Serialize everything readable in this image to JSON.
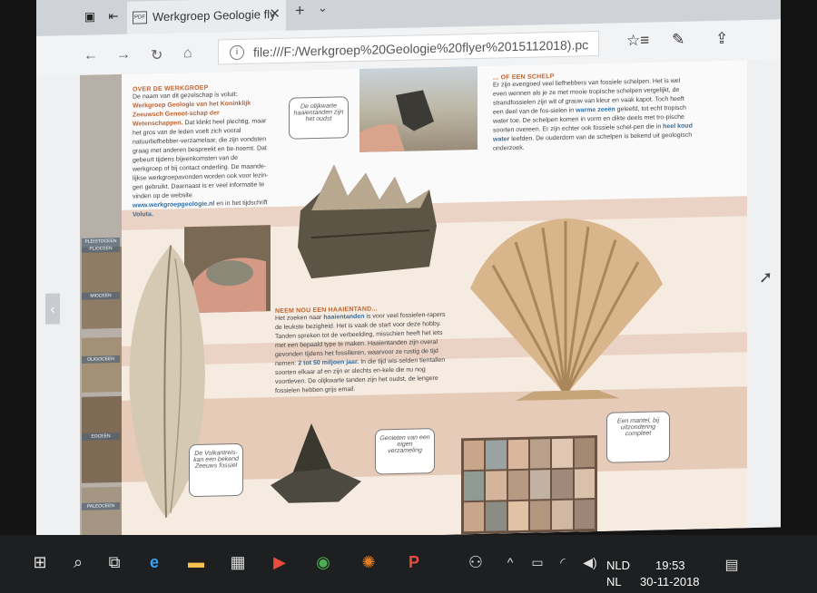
{
  "browser": {
    "tab_title": "Werkgroep Geologie fly",
    "tab_page_icon": "PDF",
    "tab_close": "✕",
    "new_tab": "+",
    "tab_menu": "⌄",
    "url": "file:///F:/Werkgroep%20Geologie%20flyer%2015112018).pc",
    "icons": [
      "tab-preview-icon",
      "set-aside-tabs-icon",
      "back-icon",
      "forward-icon",
      "refresh-icon",
      "home-icon",
      "info-icon",
      "favorite-star-icon",
      "favorites-hub-icon",
      "pen-icon",
      "share-icon"
    ]
  },
  "pdf": {
    "stripe_labels": [
      "PLEISTOCEEN",
      "PLIOCEEN",
      "MIOCEEN",
      "OLIGOCEEN",
      "EOCEEN",
      "PALEOCEEN"
    ],
    "about": {
      "heading": "OVER DE WERKGROEP",
      "p1_a": "De naam van dit gezelschap is voluit:",
      "p1_b": "Werkgroep Geologie van het Koninklijk Zeeuwsch Genoot-schap der Wetenschappen.",
      "p1_c": "Dat klinkt heel plechtig, maar het gros van de leden voelt zich vooral natuurliefhebber-verzamelaar, die zijn vondsten graag met anderen bespreekt en be-noemt. Dat gebeurt tijdens bijeenkomsten van de werkgroep of bij contact onderling. De maande-lijkse werkgroepavonden worden ook voor lezin-gen gebruikt. Daarnaast is er veel informatie te vinden op de website",
      "p1_d": "www.werkgroepgeologie.nl",
      "p1_e": "en in het tijdschrift",
      "p1_f": "Voluta."
    },
    "shell": {
      "heading": "... OF EEN SCHELP",
      "p1_a": "Er zijn evengoed veel liefhebbers van fossiele schelpen. Het is wel even wennen als je ze met mooie tropische schelpen vergelijkt, de strandfossielen zijn wit of grauw van kleur en vaak kapot. Toch heeft een deel van de fos-sielen in",
      "p1_b": "warme zeeën",
      "p1_c": "geleefd, tot echt tropisch water toe. De schelpen komen in vorm en dikte deels met tro-pische soorten overeen. Er zijn echter ook fossiele schel-pen die in",
      "p1_d": "heel koud water",
      "p1_e": "leefden. De ouderdom van de schelpen is bekend uit geologisch onderzoek."
    },
    "shark": {
      "heading": "NEEM NOU EEN HAAIENTAND...",
      "p1_a": "Het zoeken naar",
      "p1_b": "haaientanden",
      "p1_c": "is voor veel fossielen-rapers de leukste bezigheid. Het is vaak de start voor deze hobby. Tanden spreken tot de verbeelding, misschien heeft het iets met een bepaald type te maken. Haaientanden zijn overal gevonden tijdens het fossilieren, waarvoor ze rustig de tijd nemen:",
      "p1_d": "2 tot 50 miljoen jaar.",
      "p1_e": "In die tijd wis-selden tientallen soorten elkaar af en zijn er slechts en-kele die nu nog voortleven. De olijkwarte tanden zijn het oudst, de lengere fossielen hebben grijs email."
    },
    "bubbles": {
      "b1": "De olijkwarte haaientanden zijn het oudst",
      "b2": "De Volkantreis-kan een bekend Zeeuws fossiel",
      "b3": "Genieten van een eigen verzameling",
      "b4": "Een mantel, bij uitzondering compleet"
    }
  },
  "taskbar": {
    "icons": [
      "windows-start-icon",
      "search-icon",
      "task-view-icon",
      "edge-icon",
      "file-explorer-icon",
      "store-icon",
      "media-player-icon",
      "chrome-icon",
      "settings-gear-icon",
      "powerpoint-icon",
      "people-icon",
      "chevron-up-icon",
      "battery-icon",
      "wifi-icon",
      "volume-icon",
      "action-center-icon"
    ],
    "lang_top": "NLD",
    "lang_bottom": "NL",
    "time": "19:53",
    "date": "30-11-2018"
  }
}
